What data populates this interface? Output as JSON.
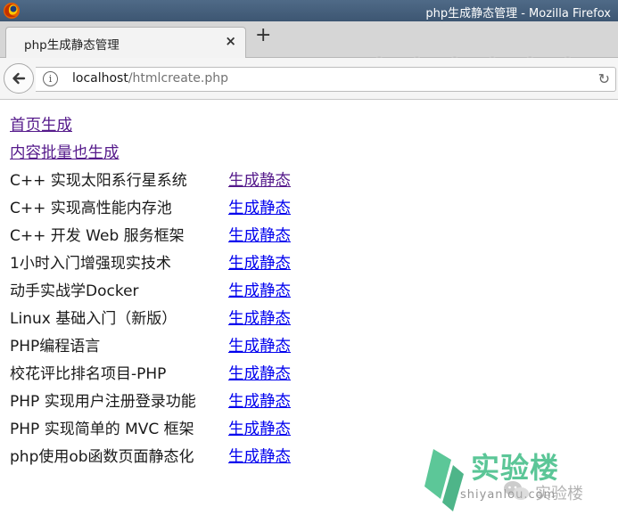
{
  "window": {
    "title": "php生成静态管理 - Mozilla Firefox",
    "app_icon": "firefox-icon"
  },
  "tab": {
    "label": "php生成静态管理",
    "close_label": "×",
    "new_tab_label": "+"
  },
  "nav": {
    "back_icon": "back-arrow-icon",
    "info_icon": "info-icon",
    "info_symbol": "i",
    "url_host": "localhost",
    "url_path": "/htmlcreate.php",
    "reload_icon": "reload-icon",
    "reload_symbol": "↻"
  },
  "page": {
    "home_link": "首页生成",
    "batch_link": "内容批量也生成",
    "generate_label": "生成静态",
    "courses": [
      {
        "title": "C++ 实现太阳系行星系统",
        "visited": true
      },
      {
        "title": "C++ 实现高性能内存池",
        "visited": false
      },
      {
        "title": "C++ 开发 Web 服务框架",
        "visited": false
      },
      {
        "title": "1小时入门增强现实技术",
        "visited": false
      },
      {
        "title": "动手实战学Docker",
        "visited": false
      },
      {
        "title": "Linux 基础入门（新版）",
        "visited": false
      },
      {
        "title": "PHP编程语言",
        "visited": false
      },
      {
        "title": "校花评比排名项目-PHP",
        "visited": false
      },
      {
        "title": "PHP 实现用户注册登录功能",
        "visited": false
      },
      {
        "title": "PHP 实现简单的 MVC 框架",
        "visited": false
      },
      {
        "title": "php使用ob函数页面静态化",
        "visited": false
      }
    ]
  },
  "watermark": {
    "brand_cn": "实验楼",
    "brand_en": "shiyanlou.com",
    "wechat_account": "实验楼"
  },
  "colors": {
    "link": "#0000ee",
    "visited_link": "#551a8b",
    "titlebar": "#4a6482",
    "brand_green": "#3fbd86"
  }
}
